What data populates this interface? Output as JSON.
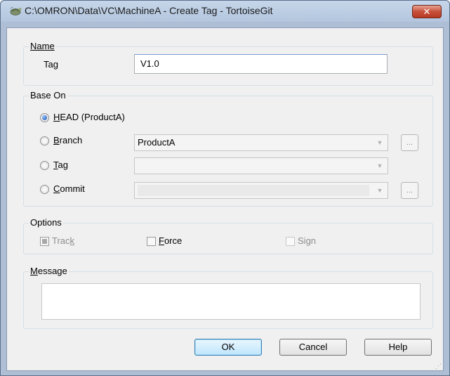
{
  "window": {
    "title": "C:\\OMRON\\Data\\VC\\MachineA - Create Tag - TortoiseGit",
    "close_label": "✕",
    "app_icon": "tortoisegit-icon"
  },
  "name_group": {
    "label": "Name",
    "tag_label": "Tag",
    "tag_value": "V1.0"
  },
  "base_on_group": {
    "label": "Base On",
    "head_label": "HEAD (ProductA)",
    "branch_label": "Branch",
    "branch_value": "ProductA",
    "tag_label": "Tag",
    "tag_value": "",
    "commit_label": "Commit",
    "commit_value": "",
    "browse_label": "...",
    "selected": "HEAD"
  },
  "options_group": {
    "label": "Options",
    "track_label": "Track",
    "force_label": "Force",
    "sign_label": "Sign",
    "track_state": "indeterminate-disabled",
    "force_state": "unchecked",
    "sign_state": "unchecked-disabled"
  },
  "message_group": {
    "label": "Message",
    "value": ""
  },
  "buttons": {
    "ok": "OK",
    "cancel": "Cancel",
    "help": "Help"
  },
  "colors": {
    "title_bg": "#b9cce3",
    "close_red": "#c7503a",
    "client_bg": "#f0f0f0",
    "default_button": "#bee6fd"
  }
}
